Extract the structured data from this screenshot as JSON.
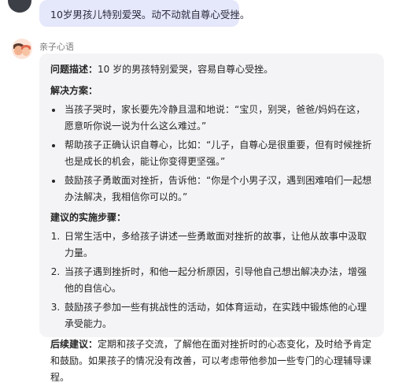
{
  "user_message": {
    "text": "10岁男孩儿特别爱哭。动不动就自尊心受挫。"
  },
  "bot": {
    "name": "亲子心语",
    "problem_label": "问题描述：",
    "problem_text": "10 岁的男孩特别爱哭，容易自尊心受挫。",
    "solution_title": "解决方案：",
    "solutions": [
      "当孩子哭时，家长要先冷静且温和地说：“宝贝，别哭，爸爸/妈妈在这，愿意听你说一说为什么这么难过。”",
      "帮助孩子正确认识自尊心，比如：“儿子，自尊心是很重要，但有时候挫折也是成长的机会，能让你变得更坚强。”",
      "鼓励孩子勇敢面对挫折，告诉他：“你是个小男子汉，遇到困难咱们一起想办法解决，我相信你可以的。”"
    ],
    "steps_title": "建议的实施步骤：",
    "steps": [
      "日常生活中，多给孩子讲述一些勇敢面对挫折的故事，让他从故事中汲取力量。",
      "当孩子遇到挫折时，和他一起分析原因，引导他自己想出解决办法，增强他的自信心。",
      "鼓励孩子参加一些有挑战性的活动，如体育运动，在实践中锻炼他的心理承受能力。"
    ],
    "followup_label": "后续建议：",
    "followup_text": "定期和孩子交流，了解他在面对挫折时的心态变化，及时给予肯定和鼓励。如果孩子的情况没有改善，可以考虑带他参加一些专门的心理辅导课程。"
  },
  "colors": {
    "user_bubble": "#e5e7fb",
    "bot_bubble": "#f4f4f6",
    "user_avatar": "#3d3f47"
  },
  "icons": {
    "user_avatar": "user-avatar",
    "bot_avatar": "parent-child-avatar"
  }
}
